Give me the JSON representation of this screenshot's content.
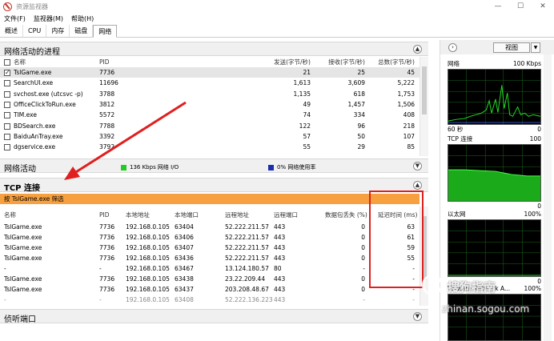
{
  "window": {
    "title": "资源监视器",
    "controls": [
      "—",
      "☐",
      "✕"
    ]
  },
  "menu": [
    "文件(F)",
    "监视器(M)",
    "帮助(H)"
  ],
  "tabs": [
    "概述",
    "CPU",
    "内存",
    "磁盘",
    "网络"
  ],
  "processes": {
    "title": "网络活动的进程",
    "headers": [
      "名称",
      "PID",
      "发送(字节/秒)",
      "接收(字节/秒)",
      "总数(字节/秒)"
    ],
    "rows": [
      {
        "name": "TslGame.exe",
        "pid": "7736",
        "send": "21",
        "recv": "25",
        "total": "45",
        "checked": true
      },
      {
        "name": "SearchUI.exe",
        "pid": "11696",
        "send": "1,613",
        "recv": "3,609",
        "total": "5,222",
        "checked": false
      },
      {
        "name": "svchost.exe (utcsvc -p)",
        "pid": "3788",
        "send": "1,135",
        "recv": "618",
        "total": "1,753",
        "checked": false
      },
      {
        "name": "OfficeClickToRun.exe",
        "pid": "3812",
        "send": "49",
        "recv": "1,457",
        "total": "1,506",
        "checked": false
      },
      {
        "name": "TIM.exe",
        "pid": "5572",
        "send": "74",
        "recv": "334",
        "total": "408",
        "checked": false
      },
      {
        "name": "BDSearch.exe",
        "pid": "7788",
        "send": "122",
        "recv": "96",
        "total": "218",
        "checked": false
      },
      {
        "name": "BaiduAnTray.exe",
        "pid": "3392",
        "send": "57",
        "recv": "50",
        "total": "107",
        "checked": false
      },
      {
        "name": "dgservice.exe",
        "pid": "3792",
        "send": "55",
        "recv": "29",
        "total": "85",
        "checked": false
      }
    ]
  },
  "network_activity": {
    "title": "网络活动",
    "io_text": "136 Kbps 网络 I/O",
    "io_color": "#22cc22",
    "usage_text": "0% 网络使用率",
    "usage_color": "#1a2fb0"
  },
  "tcp": {
    "title": "TCP 连接",
    "filter": "按 TslGame.exe 筛选",
    "headers": [
      "名称",
      "PID",
      "本地地址",
      "本地端口",
      "远程地址",
      "远程端口",
      "数据包丢失 (%)",
      "延迟时间 (ms)"
    ],
    "rows": [
      [
        "TslGame.exe",
        "7736",
        "192.168.0.105",
        "63404",
        "52.222.211.57",
        "443",
        "0",
        "63"
      ],
      [
        "TslGame.exe",
        "7736",
        "192.168.0.105",
        "63406",
        "52.222.211.57",
        "443",
        "0",
        "61"
      ],
      [
        "TslGame.exe",
        "7736",
        "192.168.0.105",
        "63407",
        "52.222.211.57",
        "443",
        "0",
        "59"
      ],
      [
        "TslGame.exe",
        "7736",
        "192.168.0.105",
        "63436",
        "52.222.211.57",
        "443",
        "0",
        "55"
      ],
      [
        "-",
        "-",
        "192.168.0.105",
        "63467",
        "13.124.180.57",
        "80",
        "-",
        "-"
      ],
      [
        "TslGame.exe",
        "7736",
        "192.168.0.105",
        "63438",
        "23.22.209.44",
        "443",
        "0",
        "-"
      ],
      [
        "TslGame.exe",
        "7736",
        "192.168.0.105",
        "63437",
        "203.208.48.67",
        "443",
        "0",
        "-"
      ],
      [
        "-",
        "-",
        "192.168.0.105",
        "63408",
        "52.222.136.223",
        "443",
        "-",
        "-"
      ]
    ]
  },
  "listening": {
    "title": "侦听端口"
  },
  "side": {
    "view_label": "视图",
    "graphs": [
      {
        "name": "网络",
        "max": "100 Kbps",
        "foot_left": "60 秒",
        "foot_right": "0"
      },
      {
        "name": "TCP 连接",
        "max": "100",
        "foot_right": "0"
      },
      {
        "name": "以太网",
        "max": "100%",
        "foot_right": "0"
      },
      {
        "name": "VMware Network A...",
        "max": "100%"
      }
    ]
  },
  "watermark": {
    "line1": "搜狗指南",
    "line2": "zhinan.sogou.com"
  },
  "accent": {
    "filter_bar": "#f6a040",
    "annotation": "#e02020",
    "graph_green": "#22dd22"
  }
}
